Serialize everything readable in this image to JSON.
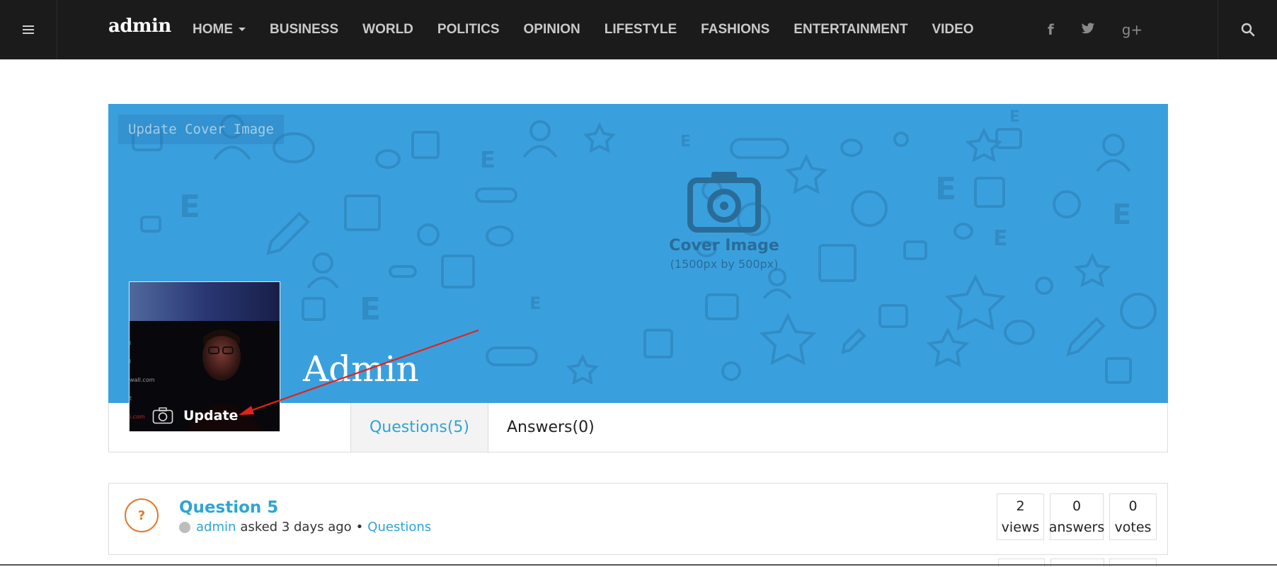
{
  "header": {
    "brand": "admin",
    "nav": [
      "HOME",
      "BUSINESS",
      "WORLD",
      "POLITICS",
      "OPINION",
      "LIFESTYLE",
      "FASHIONS",
      "ENTERTAINMENT",
      "VIDEO"
    ],
    "social": [
      "f",
      "twitter",
      "g+"
    ]
  },
  "cover": {
    "update_label": "Update Cover Image",
    "placeholder_title": "Cover Image",
    "placeholder_size": "(1500px by 500px)",
    "color": "#3aa0dd"
  },
  "profile": {
    "name": "Admin",
    "avatar_update_label": "Update",
    "avatar_text_lines": [
      "l",
      "l",
      "wall.com",
      "t",
      "i.com"
    ]
  },
  "tabs": [
    {
      "label": "Questions(5)",
      "active": true
    },
    {
      "label": "Answers(0)",
      "active": false
    }
  ],
  "questions": [
    {
      "icon": "?",
      "title": "Question 5",
      "author": "admin",
      "asked_text": "asked 3 days ago",
      "separator": "•",
      "category": "Questions",
      "stats": [
        {
          "value": "2",
          "label": "views"
        },
        {
          "value": "0",
          "label": "answers"
        },
        {
          "value": "0",
          "label": "votes"
        }
      ]
    }
  ],
  "colors": {
    "topbar": "#1b1b1b",
    "accent": "#2fa4d4",
    "question_icon": "#e07a2c",
    "annotation_arrow": "#e2231a"
  }
}
